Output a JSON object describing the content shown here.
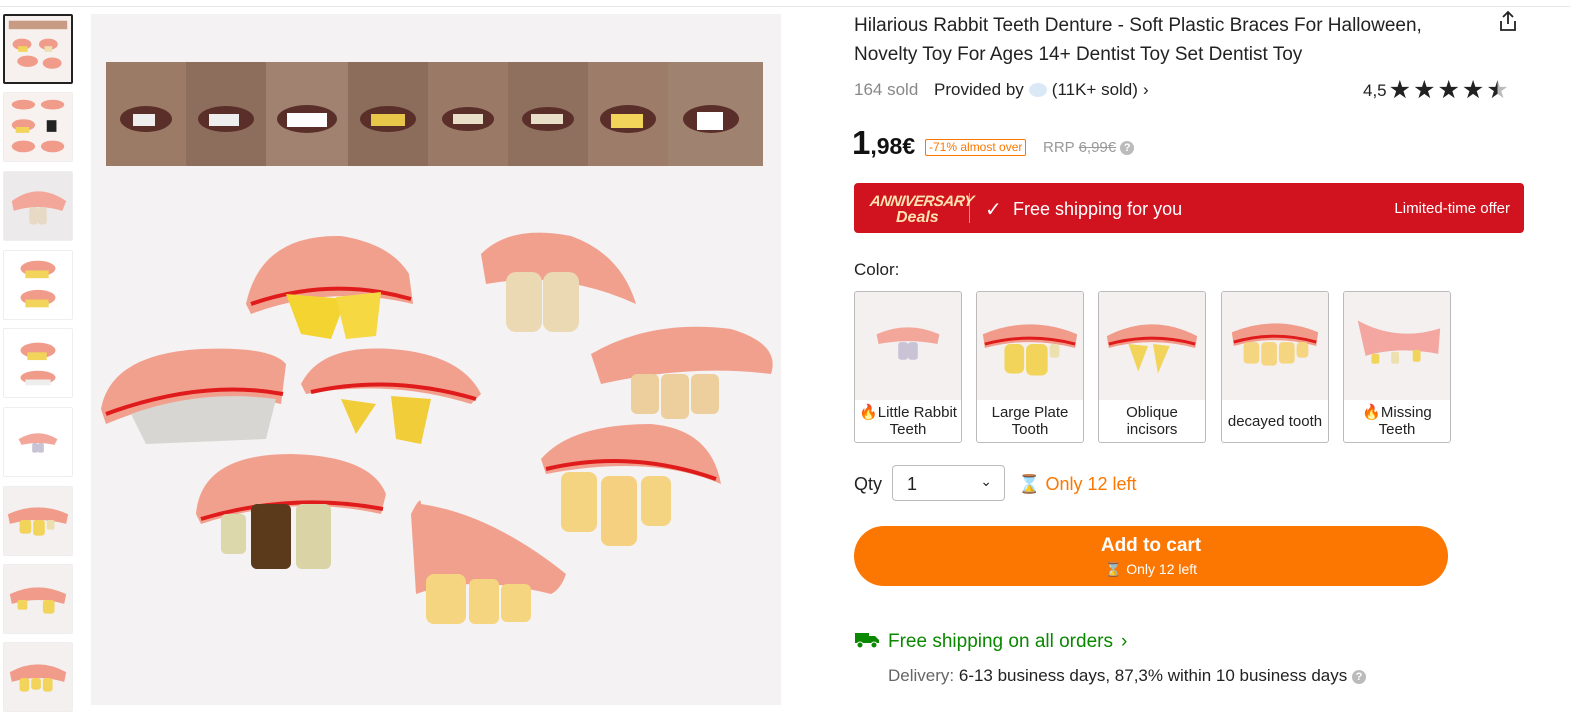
{
  "product": {
    "title": "Hilarious Rabbit Teeth Denture - Soft Plastic Braces For Halloween, Novelty Toy For Ages 14+ Dentist Toy Set Dentist Toy",
    "sold": "164 sold",
    "provided_by": "Provided by",
    "store_sold": "(11K+ sold)",
    "rating": "4,5",
    "rating_value": 4.5,
    "price_int": "1",
    "price_dec": ",98€",
    "discount": "-71% almost over",
    "rrp_label": "RRP",
    "rrp_value": "6,99€"
  },
  "banner": {
    "brand_line1": "ANNIVERSARY",
    "brand_line2": "Deals",
    "free_shipping": "Free shipping for you",
    "limited": "Limited-time offer",
    "color": "#d1121f"
  },
  "color": {
    "label": "Color:",
    "options": [
      {
        "label": "Little Rabbit Teeth",
        "hot": true
      },
      {
        "label": "Large Plate Tooth",
        "hot": false
      },
      {
        "label": "Oblique incisors",
        "hot": false
      },
      {
        "label": "decayed tooth",
        "hot": false
      },
      {
        "label": "Missing Teeth",
        "hot": true
      }
    ]
  },
  "qty": {
    "label": "Qty",
    "value": "1",
    "stock_note": "Only 12 left"
  },
  "cart": {
    "label": "Add to cart",
    "sub": "Only 12 left",
    "color": "#fb7701"
  },
  "shipping": {
    "title": "Free shipping on all orders",
    "delivery_label": "Delivery:",
    "delivery_value": "6-13 business days, 87,3% within 10 business days",
    "color": "#0a8800"
  },
  "icons": {
    "share": "share-icon",
    "star": "star-icon",
    "help": "help-icon",
    "check": "check-icon",
    "hourglass": "hourglass-icon",
    "truck": "truck-icon",
    "flame": "flame-icon",
    "chevron": "chevron-right-icon"
  },
  "help_glyph": "?"
}
